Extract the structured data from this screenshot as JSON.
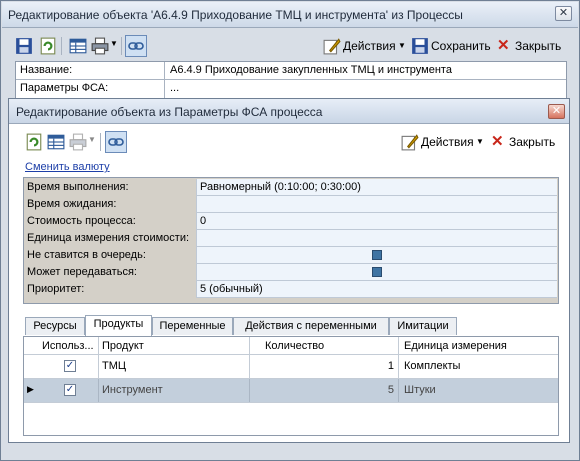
{
  "outer_window": {
    "title": "Редактирование объекта 'А6.4.9 Приходование ТМЦ и инструмента' из Процессы",
    "close_glyph": "✕",
    "toolbar": {
      "actions_label": "Действия",
      "save_label": "Сохранить",
      "close_label": "Закрыть"
    },
    "properties": [
      {
        "label": "Название:",
        "value": "А6.4.9 Приходование закупленных ТМЦ и инструмента"
      },
      {
        "label": "Параметры ФСА:",
        "value": "..."
      }
    ]
  },
  "inner_window": {
    "title": "Редактирование объекта  из Параметры ФСА процесса",
    "close_glyph": "✕",
    "toolbar": {
      "actions_label": "Действия",
      "close_label": "Закрыть"
    },
    "change_currency_link": "Сменить валюту",
    "params": [
      {
        "label": "Время выполнения:",
        "value": "Равномерный (0:10:00; 0:30:00)",
        "checkbox": false
      },
      {
        "label": "Время ожидания:",
        "value": "",
        "checkbox": false
      },
      {
        "label": "Стоимость процесса:",
        "value": "0",
        "checkbox": false
      },
      {
        "label": "Единица измерения стоимости:",
        "value": "",
        "checkbox": false
      },
      {
        "label": "Не ставится в очередь:",
        "value": "",
        "checkbox": true
      },
      {
        "label": "Может передаваться:",
        "value": "",
        "checkbox": true
      },
      {
        "label": "Приоритет:",
        "value": "5 (обычный)",
        "checkbox": false
      }
    ],
    "tabs": [
      "Ресурсы",
      "Продукты",
      "Переменные",
      "Действия с переменными",
      "Имитации"
    ],
    "active_tab": "Продукты",
    "grid": {
      "columns": [
        "Использ...",
        "Продукт",
        "Количество",
        "Единица измерения"
      ],
      "rows": [
        {
          "used": true,
          "product": "ТМЦ",
          "quantity": "1",
          "unit": "Комплекты",
          "selected": false
        },
        {
          "used": true,
          "product": "Инструмент",
          "quantity": "5",
          "unit": "Штуки",
          "selected": true
        }
      ]
    }
  },
  "colors": {
    "selection_row": "#c3cfdc",
    "link": "#1d3fa8",
    "close_red": "#d6735e"
  }
}
